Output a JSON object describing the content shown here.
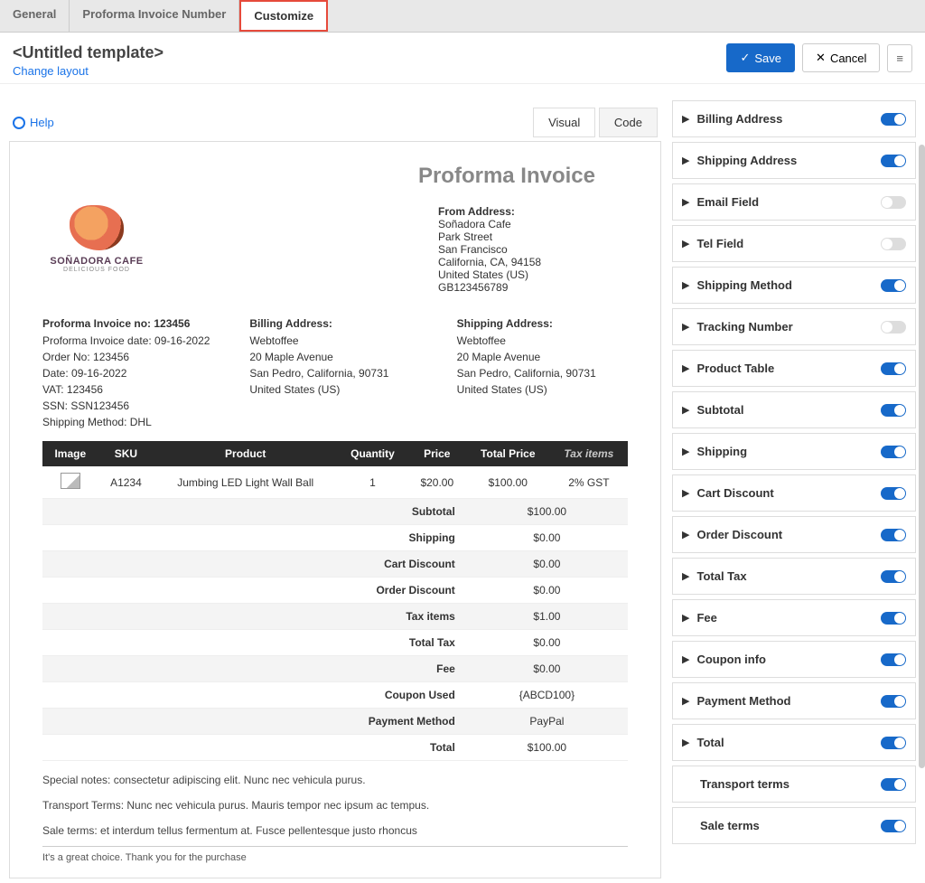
{
  "tabs": {
    "general": "General",
    "number": "Proforma Invoice Number",
    "customize": "Customize"
  },
  "header": {
    "title": "<Untitled template>",
    "change": "Change layout"
  },
  "actions": {
    "save": "Save",
    "cancel": "Cancel"
  },
  "help": "Help",
  "view": {
    "visual": "Visual",
    "code": "Code"
  },
  "invoice": {
    "title": "Proforma Invoice",
    "logo_name": "SOÑADORA CAFE",
    "logo_sub": "DELICIOUS FOOD",
    "from_label": "From Address:",
    "from_lines": [
      "Soñadora Cafe",
      "Park Street",
      "San Francisco",
      "California, CA, 94158",
      "United States (US)",
      "GB123456789"
    ],
    "info_label": "Proforma Invoice no: 123456",
    "info_lines": [
      "Proforma Invoice date: 09-16-2022",
      "Order No: 123456",
      "Date: 09-16-2022",
      "VAT: 123456",
      "SSN: SSN123456",
      "Shipping Method: DHL"
    ],
    "bill_label": "Billing Address:",
    "bill_lines": [
      "Webtoffee",
      "20 Maple Avenue",
      "San Pedro, California, 90731",
      "United States (US)"
    ],
    "ship_label": "Shipping Address:",
    "ship_lines": [
      "Webtoffee",
      "20 Maple Avenue",
      "San Pedro, California, 90731",
      "United States (US)"
    ],
    "thead": [
      "Image",
      "SKU",
      "Product",
      "Quantity",
      "Price",
      "Total Price",
      "Tax items"
    ],
    "row": {
      "sku": "A1234",
      "product": "Jumbing LED Light Wall Ball",
      "qty": "1",
      "price": "$20.00",
      "total": "$100.00",
      "tax": "2% GST"
    },
    "sums": [
      [
        "Subtotal",
        "$100.00"
      ],
      [
        "Shipping",
        "$0.00"
      ],
      [
        "Cart Discount",
        "$0.00"
      ],
      [
        "Order Discount",
        "$0.00"
      ],
      [
        "Tax items",
        "$1.00"
      ],
      [
        "Total Tax",
        "$0.00"
      ],
      [
        "Fee",
        "$0.00"
      ],
      [
        "Coupon Used",
        "{ABCD100}"
      ],
      [
        "Payment Method",
        "PayPal"
      ],
      [
        "Total",
        "$100.00"
      ]
    ],
    "note1": "Special notes: consectetur adipiscing elit. Nunc nec vehicula purus.",
    "note2": "Transport Terms: Nunc nec vehicula purus. Mauris tempor nec ipsum ac tempus.",
    "note3": "Sale terms: et interdum tellus fermentum at. Fusce pellentesque justo rhoncus",
    "footer": "It's a great choice. Thank you for the purchase"
  },
  "panels": [
    {
      "label": "Billing Address",
      "on": true,
      "arrow": true
    },
    {
      "label": "Shipping Address",
      "on": true,
      "arrow": true
    },
    {
      "label": "Email Field",
      "on": false,
      "arrow": true
    },
    {
      "label": "Tel Field",
      "on": false,
      "arrow": true
    },
    {
      "label": "Shipping Method",
      "on": true,
      "arrow": true
    },
    {
      "label": "Tracking Number",
      "on": false,
      "arrow": true
    },
    {
      "label": "Product Table",
      "on": true,
      "arrow": true
    },
    {
      "label": "Subtotal",
      "on": true,
      "arrow": true
    },
    {
      "label": "Shipping",
      "on": true,
      "arrow": true
    },
    {
      "label": "Cart Discount",
      "on": true,
      "arrow": true
    },
    {
      "label": "Order Discount",
      "on": true,
      "arrow": true
    },
    {
      "label": "Total Tax",
      "on": true,
      "arrow": true
    },
    {
      "label": "Fee",
      "on": true,
      "arrow": true
    },
    {
      "label": "Coupon info",
      "on": true,
      "arrow": true
    },
    {
      "label": "Payment Method",
      "on": true,
      "arrow": true
    },
    {
      "label": "Total",
      "on": true,
      "arrow": true
    },
    {
      "label": "Transport terms",
      "on": true,
      "arrow": false,
      "sub": true
    },
    {
      "label": "Sale terms",
      "on": true,
      "arrow": false,
      "sub": true
    }
  ]
}
